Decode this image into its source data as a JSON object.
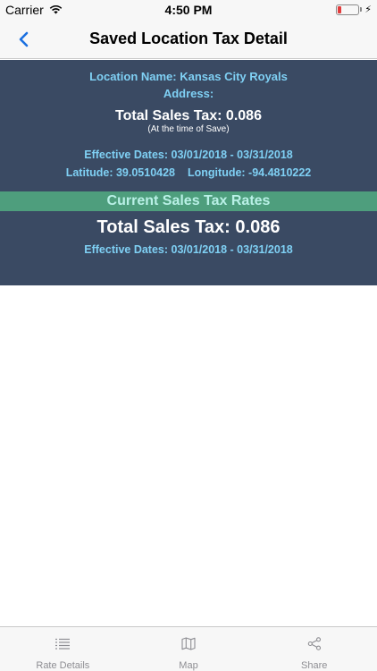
{
  "status_bar": {
    "carrier": "Carrier",
    "time": "4:50 PM",
    "battery_level_percent": 10
  },
  "nav": {
    "title": "Saved Location Tax Detail"
  },
  "saved": {
    "location_name": "Location Name: Kansas City Royals",
    "address": "Address:",
    "total_sales_tax": "Total Sales Tax: 0.086",
    "note": "(At the time of Save)",
    "effective_dates": "Effective Dates: 03/01/2018 - 03/31/2018",
    "latitude": "Latitude: 39.0510428",
    "longitude": "Longitude: -94.4810222"
  },
  "current": {
    "header": "Current Sales Tax Rates",
    "total_sales_tax": "Total Sales Tax: 0.086",
    "effective_dates": "Effective Dates: 03/01/2018 - 03/31/2018"
  },
  "tabs": [
    {
      "label": "Rate Details",
      "icon": "list-icon"
    },
    {
      "label": "Map",
      "icon": "map-icon"
    },
    {
      "label": "Share",
      "icon": "share-icon"
    }
  ],
  "colors": {
    "panel": "#3a4a63",
    "accent_text": "#7fd0f4",
    "rates_bar": "#4e9e7d",
    "back_chevron": "#1a6fe0"
  }
}
